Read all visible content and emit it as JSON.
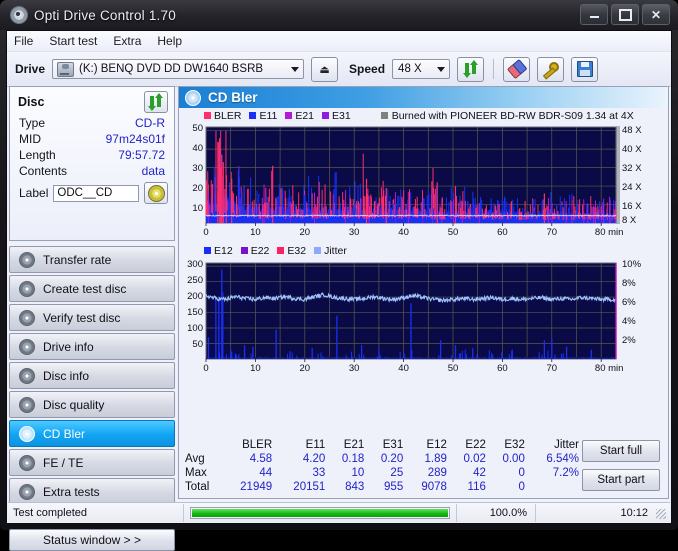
{
  "window": {
    "title": "Opti Drive Control 1.70",
    "app_icon": "disc-icon",
    "minimize": "–",
    "maximize": "□",
    "close": "✕"
  },
  "menu": [
    "File",
    "Start test",
    "Extra",
    "Help"
  ],
  "toolbar": {
    "drive_label": "Drive",
    "drive_value": "(K:)  BENQ DVD DD DW1640 BSRB",
    "eject_label": "⏏",
    "speed_label": "Speed",
    "speed_value": "48 X",
    "refresh_icon": "refresh-icon",
    "eraser_icon": "eraser-icon",
    "tools_icon": "tools-icon",
    "save_icon": "save-icon"
  },
  "disc": {
    "title": "Disc",
    "refresh_icon": "refresh-icon",
    "rows": [
      {
        "key": "Type",
        "value": "CD-R"
      },
      {
        "key": "MID",
        "value": "97m24s01f"
      },
      {
        "key": "Length",
        "value": "79:57.72"
      },
      {
        "key": "Contents",
        "value": "data"
      }
    ],
    "label_key": "Label",
    "label_value": "ODC__CD",
    "disc_icon": "cd-icon"
  },
  "nav": {
    "items": [
      {
        "label": "Transfer rate",
        "active": false
      },
      {
        "label": "Create test disc",
        "active": false
      },
      {
        "label": "Verify test disc",
        "active": false
      },
      {
        "label": "Drive info",
        "active": false
      },
      {
        "label": "Disc info",
        "active": false
      },
      {
        "label": "Disc quality",
        "active": false
      },
      {
        "label": "CD Bler",
        "active": true
      },
      {
        "label": "FE / TE",
        "active": false
      },
      {
        "label": "Extra tests",
        "active": false
      }
    ],
    "status_window": "Status window > >"
  },
  "content": {
    "title": "CD Bler",
    "title_icon": "disc-icon",
    "burn_note": "Burned with PIONEER BD-RW   BDR-S09 1.34 at 4X",
    "burn_note_swatch": "#808080"
  },
  "actions": {
    "start_full": "Start full",
    "start_part": "Start part"
  },
  "stats": {
    "columns": [
      "BLER",
      "E11",
      "E21",
      "E31",
      "E12",
      "E22",
      "E32",
      "Jitter"
    ],
    "rows": [
      {
        "name": "Avg",
        "values": [
          "4.58",
          "4.20",
          "0.18",
          "0.20",
          "1.89",
          "0.02",
          "0.00",
          "6.54%"
        ]
      },
      {
        "name": "Max",
        "values": [
          "44",
          "33",
          "10",
          "25",
          "289",
          "42",
          "0",
          "7.2%"
        ]
      },
      {
        "name": "Total",
        "values": [
          "21949",
          "20151",
          "843",
          "955",
          "9078",
          "116",
          "0",
          ""
        ]
      }
    ]
  },
  "statusbar": {
    "text": "Test completed",
    "progress_percent": 100.0,
    "progress_label": "100.0%",
    "time": "10:12"
  },
  "chart_data": [
    {
      "type": "area",
      "name": "cd-bler-errors",
      "title": "CD Bler",
      "xlabel": "min",
      "ylabel": "",
      "xlim": [
        0,
        83
      ],
      "ylim": [
        0,
        52
      ],
      "xticks": [
        0,
        10,
        20,
        30,
        40,
        50,
        60,
        70,
        80
      ],
      "xtick_labels": [
        "0",
        "10",
        "20",
        "30",
        "40",
        "50",
        "60",
        "70",
        "80 min"
      ],
      "yticks": [
        10,
        20,
        30,
        40,
        50
      ],
      "ytick_labels": [
        "10",
        "20",
        "30",
        "40",
        "50"
      ],
      "y2lim": [
        0,
        52
      ],
      "y2ticks": [
        8,
        16,
        24,
        32,
        40,
        48
      ],
      "y2tick_labels": [
        "8 X",
        "16 X",
        "24 X",
        "32 X",
        "40 X",
        "48 X"
      ],
      "grid": true,
      "plot_bg": "#0a0a46",
      "legend_position": "top-left",
      "legend": [
        {
          "name": "BLER",
          "color": "#ff2f6e"
        },
        {
          "name": "E11",
          "color": "#1a2ff5"
        },
        {
          "name": "E21",
          "color": "#b41ad6"
        },
        {
          "name": "E31",
          "color": "#8f1ae0"
        }
      ],
      "series": [
        {
          "name": "E11",
          "color": "#1a2ff5",
          "x": [
            0,
            1,
            2,
            3,
            4,
            5,
            6,
            7,
            8,
            9,
            10,
            11,
            12,
            13,
            14,
            15,
            16,
            17,
            18,
            19,
            20,
            21,
            22,
            23,
            24,
            25,
            26,
            27,
            28,
            29,
            30,
            31,
            32,
            33,
            34,
            35,
            36,
            37,
            38,
            39,
            40,
            41,
            42,
            43,
            44,
            45,
            46,
            47,
            48,
            49,
            50,
            51,
            52,
            53,
            54,
            55,
            56,
            57,
            58,
            59,
            60,
            61,
            62,
            63,
            64,
            65,
            66,
            67,
            68,
            69,
            70,
            71,
            72,
            73,
            74,
            75,
            76,
            77,
            78,
            79,
            80
          ],
          "values": [
            9,
            11,
            13,
            12,
            14,
            12,
            10,
            9,
            8,
            9,
            8,
            7,
            8,
            7,
            8,
            8,
            7,
            7,
            7,
            8,
            7,
            8,
            7,
            8,
            7,
            7,
            8,
            7,
            7,
            8,
            7,
            7,
            7,
            7,
            7,
            7,
            8,
            7,
            7,
            7,
            7,
            7,
            7,
            7,
            7,
            7,
            6,
            6,
            6,
            6,
            6,
            6,
            6,
            6,
            6,
            6,
            6,
            6,
            6,
            6,
            6,
            6,
            6,
            5,
            5,
            5,
            5,
            5,
            5,
            5,
            5,
            5,
            5,
            5,
            5,
            5,
            5,
            5,
            5,
            5,
            5
          ]
        },
        {
          "name": "BLER",
          "color": "#ff2f6e",
          "x": [
            0,
            1,
            2,
            3,
            4,
            5,
            6,
            7,
            8,
            9,
            10,
            11,
            12,
            13,
            14,
            15,
            16,
            17,
            18,
            19,
            20,
            21,
            22,
            23,
            24,
            25,
            26,
            27,
            28,
            29,
            30,
            31,
            32,
            33,
            34,
            35,
            36,
            37,
            38,
            39,
            40,
            41,
            42,
            43,
            44,
            45,
            46,
            47,
            48,
            49,
            50,
            51,
            52,
            53,
            54,
            55,
            56,
            57,
            58,
            59,
            60,
            61,
            62,
            63,
            64,
            65,
            66,
            67,
            68,
            69,
            70,
            71,
            72,
            73,
            74,
            75,
            76,
            77,
            78,
            79,
            80
          ],
          "values": [
            14,
            18,
            44,
            37,
            30,
            24,
            20,
            17,
            15,
            14,
            16,
            13,
            19,
            20,
            12,
            14,
            15,
            13,
            12,
            16,
            14,
            18,
            12,
            13,
            12,
            11,
            14,
            12,
            11,
            13,
            12,
            11,
            24,
            12,
            11,
            12,
            18,
            11,
            11,
            12,
            13,
            11,
            11,
            11,
            11,
            10,
            22,
            10,
            10,
            10,
            11,
            10,
            10,
            10,
            10,
            10,
            9,
            9,
            9,
            9,
            9,
            9,
            12,
            8,
            8,
            8,
            8,
            8,
            8,
            8,
            8,
            8,
            8,
            8,
            13,
            8,
            8,
            8,
            8,
            8,
            8
          ]
        },
        {
          "name": "write-speed",
          "color": "#cfd6ff",
          "x": [
            0,
            10,
            20,
            30,
            40,
            50,
            60,
            70,
            80
          ],
          "values": [
            4,
            4,
            4,
            4,
            4,
            4,
            4,
            4,
            4
          ]
        }
      ]
    },
    {
      "type": "line",
      "name": "cd-bler-jitter",
      "title": "",
      "xlabel": "min",
      "ylabel": "",
      "xlim": [
        0,
        83
      ],
      "ylim": [
        0,
        310
      ],
      "xticks": [
        0,
        10,
        20,
        30,
        40,
        50,
        60,
        70,
        80
      ],
      "xtick_labels": [
        "0",
        "10",
        "20",
        "30",
        "40",
        "50",
        "60",
        "70",
        "80 min"
      ],
      "yticks": [
        50,
        100,
        150,
        200,
        250,
        300
      ],
      "ytick_labels": [
        "50",
        "100",
        "150",
        "200",
        "250",
        "300"
      ],
      "y2lim": [
        0,
        10
      ],
      "y2ticks": [
        2,
        4,
        6,
        8,
        10
      ],
      "y2tick_labels": [
        "2%",
        "4%",
        "6%",
        "8%",
        "10%"
      ],
      "grid": true,
      "plot_bg": "#0a0a46",
      "legend_position": "top-left",
      "legend": [
        {
          "name": "E12",
          "color": "#1a2ff5"
        },
        {
          "name": "E22",
          "color": "#7a12c8"
        },
        {
          "name": "E32",
          "color": "#ff2060"
        },
        {
          "name": "Jitter",
          "color": "#8fa8ff"
        }
      ],
      "series": [
        {
          "name": "Jitter",
          "color": "#9fc2ff",
          "unit": "%",
          "x": [
            0,
            2,
            4,
            6,
            8,
            10,
            12,
            14,
            16,
            18,
            20,
            22,
            24,
            26,
            28,
            30,
            32,
            34,
            36,
            38,
            40,
            42,
            44,
            46,
            48,
            50,
            52,
            54,
            56,
            58,
            60,
            62,
            64,
            66,
            68,
            70,
            72,
            74,
            76,
            78,
            80
          ],
          "values": [
            6.6,
            6.3,
            6.2,
            6.5,
            6.3,
            6.2,
            6.4,
            6.3,
            6.5,
            6.3,
            6.2,
            6.5,
            6.7,
            6.4,
            6.3,
            6.2,
            6.3,
            6.5,
            6.3,
            6.2,
            6.4,
            6.6,
            6.4,
            6.2,
            6.1,
            6.2,
            6.3,
            6.2,
            6.3,
            6.4,
            6.2,
            6.3,
            6.2,
            6.3,
            6.4,
            6.2,
            6.3,
            6.2,
            6.4,
            6.3,
            6.2
          ]
        },
        {
          "name": "E12-spikes",
          "color": "#1a2ff5",
          "x": [
            0.5,
            2.0,
            2.6,
            3.2,
            3.4,
            5.0,
            7.8,
            9.5,
            14.2,
            17.0,
            21.5,
            26.5,
            31.5,
            35.0,
            41.5,
            47.5,
            50.5,
            54.0,
            62.0,
            68.5,
            70.0,
            73.0,
            78.0
          ],
          "values": [
            70,
            200,
            200,
            289,
            215,
            30,
            45,
            40,
            95,
            25,
            35,
            140,
            45,
            30,
            180,
            60,
            45,
            35,
            30,
            60,
            65,
            40,
            30
          ]
        }
      ]
    }
  ]
}
